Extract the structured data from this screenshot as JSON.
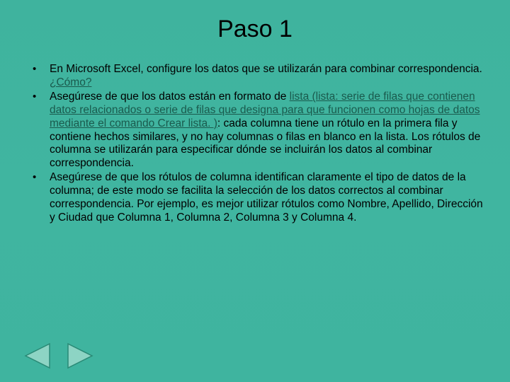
{
  "title": "Paso 1",
  "bullets": [
    {
      "pre": "En Microsoft Excel, configure los datos que se utilizarán para combinar correspondencia. ",
      "link": " ¿Cómo?",
      "post": ""
    },
    {
      "pre": "Asegúrese de que los datos están en formato de ",
      "link": "lista (lista: serie de filas que contienen datos relacionados o serie de filas que designa para que funcionen como hojas de datos mediante el comando Crear lista. )",
      "post": ": cada columna tiene un rótulo en la primera fila y contiene hechos similares, y no hay columnas o filas en blanco en la lista. Los rótulos de columna se utilizarán para especificar dónde se incluirán los datos al combinar correspondencia."
    },
    {
      "pre": "Asegúrese de que los rótulos de columna identifican claramente el tipo de datos de la columna; de este modo se facilita la selección de los datos correctos al combinar correspondencia. Por ejemplo, es mejor utilizar rótulos como Nombre, Apellido, Dirección y Ciudad que Columna 1, Columna 2, Columna 3 y Columna 4.",
      "link": "",
      "post": ""
    }
  ],
  "nav": {
    "prev": "previous-slide",
    "next": "next-slide"
  }
}
